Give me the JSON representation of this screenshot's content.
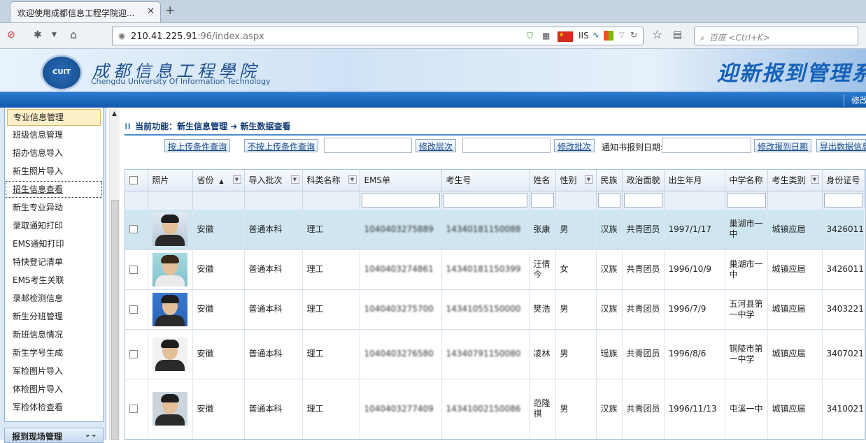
{
  "browser": {
    "tab_title": "欢迎使用成都信息工程学院迎...",
    "url_host": "210.41.225.91",
    "url_path": ":96/index.aspx",
    "iis_label": "IIS",
    "search_placeholder": "百度 <Ctrl+K>"
  },
  "banner": {
    "logo_text": "CUIT",
    "school_cn": "成都信息工程學院",
    "school_en": "Chengdu University Of Information Technology",
    "system_title": "迎新报到管理系",
    "top_link": "修改"
  },
  "sidebar": {
    "items": [
      "专业信息管理",
      "班级信息管理",
      "招办信息导入",
      "新生照片导入",
      "招生信息查看",
      "新生专业异动",
      "录取通知打印",
      "EMS通知打印",
      "特快登记清单",
      "EMS考生关联",
      "录邮检测信息",
      "新生分班管理",
      "新班信息情况",
      "新生学号生成",
      "军检图片导入",
      "体检图片导入",
      "军检体检查看"
    ],
    "section2": "报到现场管理"
  },
  "content": {
    "crumb": "当前功能：新生信息管理 ➜ 新生数据查看",
    "buttons": {
      "upload_query": "按上传条件查询",
      "no_upload_query": "不按上传条件查询",
      "modify_level": "修改层次",
      "modify_batch": "修改批次",
      "notice_date_label": "通知书报到日期:",
      "modify_date": "修改报到日期",
      "export": "导出数据信息"
    }
  },
  "table": {
    "headers": [
      "照片",
      "省份",
      "导入批次",
      "科类名称",
      "EMS单",
      "考生号",
      "姓名",
      "性别",
      "民族",
      "政治面貌",
      "出生年月",
      "中学名称",
      "考生类别",
      "身份证号"
    ],
    "rows": [
      {
        "province": "安徽",
        "batch": "普通本科",
        "category": "理工",
        "ems": "1040403275889",
        "exam_no": "14340181150088",
        "name": "张康",
        "gender": "男",
        "ethnic": "汉族",
        "political": "共青团员",
        "birth": "1997/1/17",
        "school": "巢湖市一中",
        "type": "城镇应届",
        "id": "3426011"
      },
      {
        "province": "安徽",
        "batch": "普通本科",
        "category": "理工",
        "ems": "1040403274861",
        "exam_no": "14340181150399",
        "name": "汪倩今",
        "gender": "女",
        "ethnic": "汉族",
        "political": "共青团员",
        "birth": "1996/10/9",
        "school": "巢湖市一中",
        "type": "城镇应届",
        "id": "3426011"
      },
      {
        "province": "安徽",
        "batch": "普通本科",
        "category": "理工",
        "ems": "1040403275700",
        "exam_no": "14341055150000",
        "name": "樊浩",
        "gender": "男",
        "ethnic": "汉族",
        "political": "共青团员",
        "birth": "1996/7/9",
        "school": "五河县第一中学",
        "type": "城镇应届",
        "id": "3403221"
      },
      {
        "province": "安徽",
        "batch": "普通本科",
        "category": "理工",
        "ems": "1040403276580",
        "exam_no": "14340791150080",
        "name": "凌林",
        "gender": "男",
        "ethnic": "瑶族",
        "political": "共青团员",
        "birth": "1996/8/6",
        "school": "铜陵市第一中学",
        "type": "城镇应届",
        "id": "3407021"
      },
      {
        "province": "安徽",
        "batch": "普通本科",
        "category": "理工",
        "ems": "1040403277409",
        "exam_no": "14341002150086",
        "name": "范隆祺",
        "gender": "男",
        "ethnic": "汉族",
        "political": "共青团员",
        "birth": "1996/11/13",
        "school": "屯溪一中",
        "type": "城镇应届",
        "id": "3410021"
      }
    ]
  },
  "colors": {
    "accent": "#1458aa",
    "selected_row": "#cfe6f0",
    "active_menu": "#fdf0c9"
  }
}
